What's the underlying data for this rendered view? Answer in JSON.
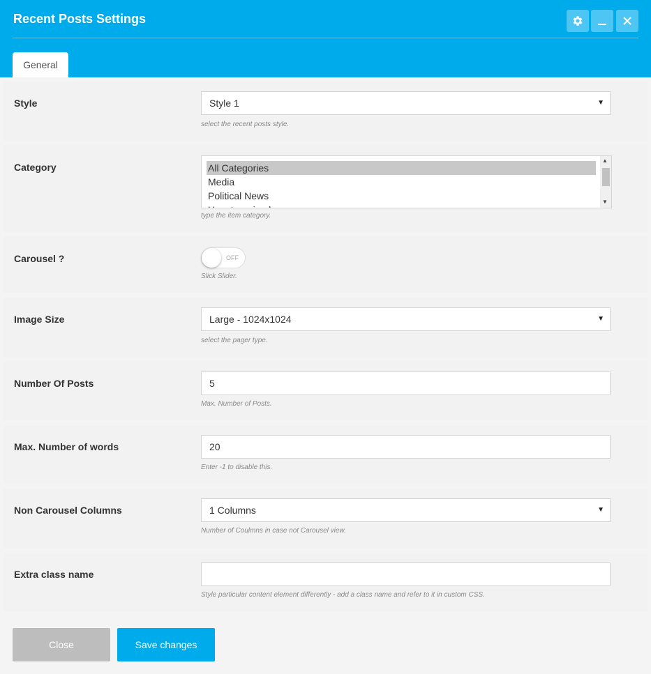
{
  "window": {
    "title": "Recent Posts Settings",
    "accent_color": "#00abec",
    "controls": [
      "gear-icon",
      "minimize-icon",
      "close-icon"
    ]
  },
  "tabs": [
    {
      "label": "General"
    }
  ],
  "form": {
    "style": {
      "label": "Style",
      "value": "Style 1",
      "hint": "select the recent posts style."
    },
    "category": {
      "label": "Category",
      "options": [
        "All Categories",
        "Media",
        "Political News",
        "Uncategorized"
      ],
      "selected": "All Categories",
      "hint": "type the item category."
    },
    "carousel": {
      "label": "Carousel ?",
      "state": "OFF",
      "hint": "Slick Slider."
    },
    "image_size": {
      "label": "Image Size",
      "value": "Large - 1024x1024",
      "hint": "select the pager type."
    },
    "number_of_posts": {
      "label": "Number Of Posts",
      "value": "5",
      "hint": "Max. Number of Posts."
    },
    "max_words": {
      "label": "Max. Number of words",
      "value": "20",
      "hint": "Enter -1 to disable this."
    },
    "non_carousel_columns": {
      "label": "Non Carousel Columns",
      "value": "1 Columns",
      "hint": "Number of Coulmns in case not Carousel view."
    },
    "extra_class": {
      "label": "Extra class name",
      "value": "",
      "hint": "Style particular content element differently - add a class name and refer to it in custom CSS."
    }
  },
  "footer": {
    "close_label": "Close",
    "save_label": "Save changes"
  }
}
